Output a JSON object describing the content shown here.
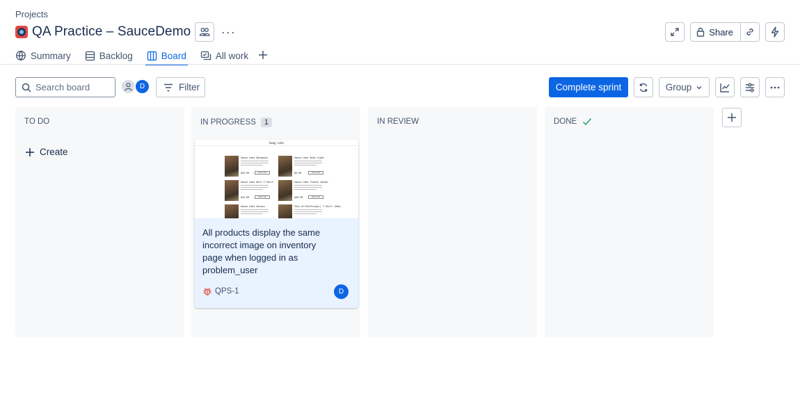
{
  "header": {
    "breadcrumb": "Projects",
    "title": "QA Practice – SauceDemo",
    "more_label": "···",
    "share_label": "Share"
  },
  "tabs": [
    {
      "label": "Summary",
      "icon": "globe-icon"
    },
    {
      "label": "Backlog",
      "icon": "backlog-icon"
    },
    {
      "label": "Board",
      "icon": "board-icon",
      "active": true
    },
    {
      "label": "All work",
      "icon": "all-work-icon"
    }
  ],
  "toolbar": {
    "search_placeholder": "Search board",
    "avatar_initial": "D",
    "filter_label": "Filter",
    "complete_sprint_label": "Complete sprint",
    "group_label": "Group"
  },
  "columns": [
    {
      "name": "TO DO",
      "count": "",
      "create_label": "Create"
    },
    {
      "name": "IN PROGRESS",
      "count": "1"
    },
    {
      "name": "IN REVIEW",
      "count": ""
    },
    {
      "name": "DONE",
      "count": "",
      "done_check": true
    }
  ],
  "card": {
    "summary": "All products display the same incorrect image on inventory page when logged in as problem_user",
    "key": "QPS-1",
    "issue_type_icon": "bug-icon",
    "assignee_initial": "D",
    "thumbnail": {
      "app_title": "Swag Labs",
      "items": [
        {
          "name": "Sauce Labs Backpack",
          "price": "$29.99"
        },
        {
          "name": "Sauce Labs Bike Light",
          "price": "$9.99"
        },
        {
          "name": "Sauce Labs Bolt T-Shirt",
          "price": "$15.99"
        },
        {
          "name": "Sauce Labs Fleece Jacket",
          "price": "$49.99"
        },
        {
          "name": "Sauce Labs Onesie",
          "price": ""
        },
        {
          "name": "Test.allTheThings() T-Shirt (Red)",
          "price": ""
        }
      ],
      "button_label": "Add to cart"
    }
  },
  "colors": {
    "accent": "#0c66e4",
    "card_bg": "#e9f2ff",
    "column_bg": "#f7f8f9",
    "bug_red": "#e2483d",
    "done_green": "#22a06b"
  }
}
